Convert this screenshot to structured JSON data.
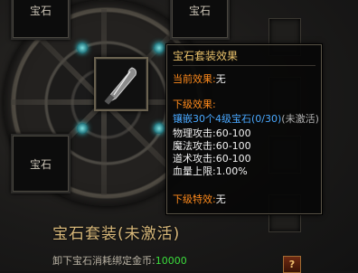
{
  "slots": {
    "top_left_label": "宝石",
    "top_right_label": "宝石",
    "bottom_left_label": "宝石"
  },
  "panel": {
    "title": "宝石套装(未激活)",
    "cost_label": "卸下宝石消耗绑定金币:",
    "cost_value": "10000",
    "help_button": "?"
  },
  "tooltip": {
    "title": "宝石套装效果",
    "current_label": "当前效果:",
    "current_value": "无",
    "next_label": "下级效果:",
    "inlay_text": "镶嵌30个4级宝石(0/30)",
    "inlay_status": "(未激活)",
    "stats": [
      {
        "label": "物理攻击:",
        "value": "60-100"
      },
      {
        "label": "魔法攻击:",
        "value": "60-100"
      },
      {
        "label": "道术攻击:",
        "value": "60-100"
      },
      {
        "label": "血量上限:",
        "value": "1.00%"
      }
    ],
    "special_label": "下级特效:",
    "special_value": "无"
  },
  "colors": {
    "title_gold": "#e8c06a",
    "label_orange": "#ff8a1c",
    "inlay_blue": "#49a8ff",
    "cost_green": "#3cde3c"
  }
}
